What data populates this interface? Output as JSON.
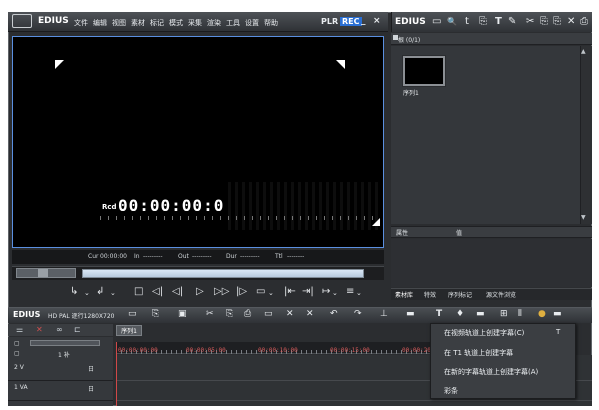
{
  "app": {
    "logo_badge": "",
    "logo_text": "EDIUS",
    "menu": [
      "文件",
      "编辑",
      "视图",
      "素材",
      "标记",
      "模式",
      "采集",
      "渲染",
      "工具",
      "设置",
      "帮助"
    ],
    "mode_plr": "PLR",
    "mode_rec": "REC",
    "minimize": "_",
    "close": "×"
  },
  "player": {
    "timecode_label": "Rcd",
    "timecode_value": "00:00:00:0",
    "info": {
      "cur_label": "Cur",
      "cur_value": "00:00:00",
      "in_label": "In",
      "in_value": "---------",
      "out_label": "Out",
      "out_value": "---------",
      "dur_label": "Dur",
      "dur_value": "---------",
      "ttl_label": "Ttl",
      "ttl_value": "--------"
    },
    "transport": [
      "↳",
      "⌄",
      "↲",
      "⌄",
      "□",
      "◁|",
      "◁|",
      "▷",
      "▷▷",
      "|▷",
      "▭",
      "⌄",
      "|⇤",
      "⇥|",
      "↦",
      "⌄",
      "≡",
      "⌄"
    ]
  },
  "bin": {
    "title": "EDIUS",
    "icons": [
      "▭",
      "🔍",
      "t",
      "⎘",
      "T",
      "✎",
      "✂",
      "⎘",
      "⎘",
      "✕",
      "⎙",
      "≡"
    ],
    "folder_label": "根 (0/1)",
    "clip_name": "序列1",
    "properties_label": "属性",
    "value_label": "值",
    "tabs": [
      "素材库",
      "特效",
      "序列标记",
      "源文件浏览"
    ]
  },
  "timeline": {
    "logo": "EDIUS",
    "project": "HD PAL 逐行1280X720",
    "sequence_tab": "序列1",
    "ruler": [
      "00:00:00:00",
      "00:00:05:00",
      "00:00:10:00",
      "00:00:15:00",
      "00:00:20:0"
    ],
    "tracks": [
      {
        "id": "2 V",
        "mark": "日"
      },
      {
        "id": "1 VA",
        "mark": "日"
      }
    ],
    "header_row_value": "1 补"
  },
  "context_menu": {
    "items": [
      {
        "label": "在视频轨道上创建字幕(C)",
        "key": "T"
      },
      {
        "label": "在 T1 轨道上创建字幕",
        "key": ""
      },
      {
        "label": "在新的字幕轨道上创建字幕(A)",
        "key": ""
      },
      {
        "label": "彩条",
        "key": ""
      }
    ]
  }
}
